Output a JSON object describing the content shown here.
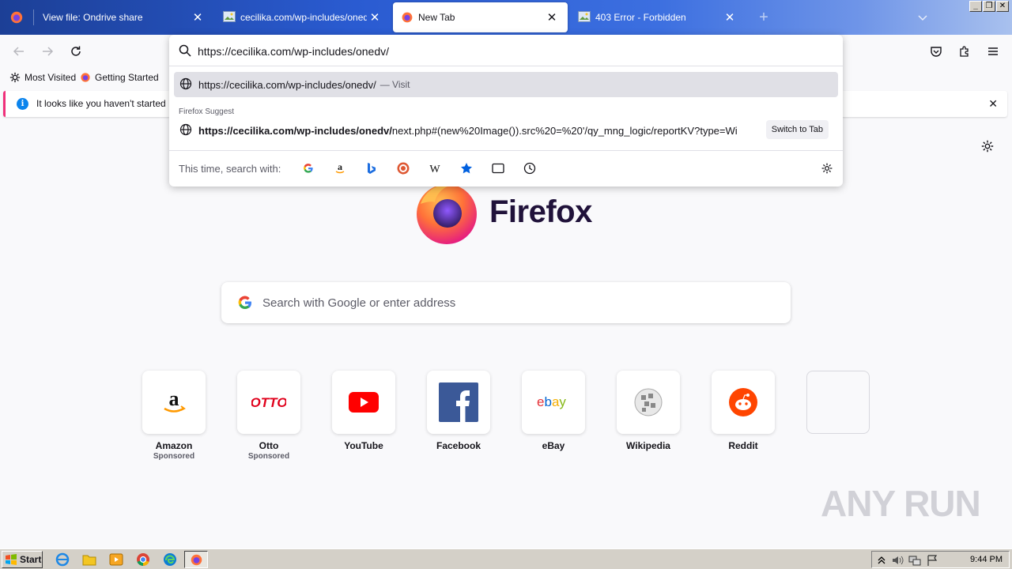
{
  "tabs": [
    {
      "title": "View file: Ondrive share",
      "active": false
    },
    {
      "title": "cecilika.com/wp-includes/onedv/next.php",
      "active": false
    },
    {
      "title": "New Tab",
      "active": true
    },
    {
      "title": "403 Error - Forbidden",
      "active": false
    }
  ],
  "new_tab_symbol": "+",
  "bookmarks": [
    {
      "label": "Most Visited"
    },
    {
      "label": "Getting Started"
    }
  ],
  "notice": {
    "text": "It looks like you haven't started Firefox in a while."
  },
  "urlbar": {
    "value": "https://cecilika.com/wp-includes/onedv/",
    "results": [
      {
        "url": "https://cecilika.com/wp-includes/onedv/",
        "action": "— Visit"
      }
    ],
    "suggest_label": "Firefox Suggest",
    "suggestion": {
      "url_bold": "https://cecilika.com/wp-includes/onedv/",
      "url_rest": "next.php#(new%20Image()).src%20=%20'/qy_mng_logic/reportKV?type=Wi",
      "action": "Switch to Tab"
    },
    "search_with_label": "This time, search with:",
    "engines": [
      "google-icon",
      "amazon-icon",
      "bing-icon",
      "duckduckgo-icon",
      "wikipedia-icon",
      "bookmarks-icon",
      "tabs-icon",
      "history-icon"
    ]
  },
  "content": {
    "brand": "Firefox",
    "search_placeholder": "Search with Google or enter address",
    "top_sites": [
      {
        "label": "Amazon",
        "sponsored": "Sponsored"
      },
      {
        "label": "Otto",
        "sponsored": "Sponsored"
      },
      {
        "label": "YouTube",
        "sponsored": ""
      },
      {
        "label": "Facebook",
        "sponsored": ""
      },
      {
        "label": "eBay",
        "sponsored": ""
      },
      {
        "label": "Wikipedia",
        "sponsored": ""
      },
      {
        "label": "Reddit",
        "sponsored": ""
      },
      {
        "label": "",
        "sponsored": ""
      }
    ]
  },
  "watermark": "ANY RUN",
  "taskbar": {
    "start_label": "Start",
    "time": "9:44 PM"
  },
  "colors": {
    "accent": "#0b84ed",
    "notice_border": "#f0307a",
    "selected_row": "#e0e0e6"
  }
}
